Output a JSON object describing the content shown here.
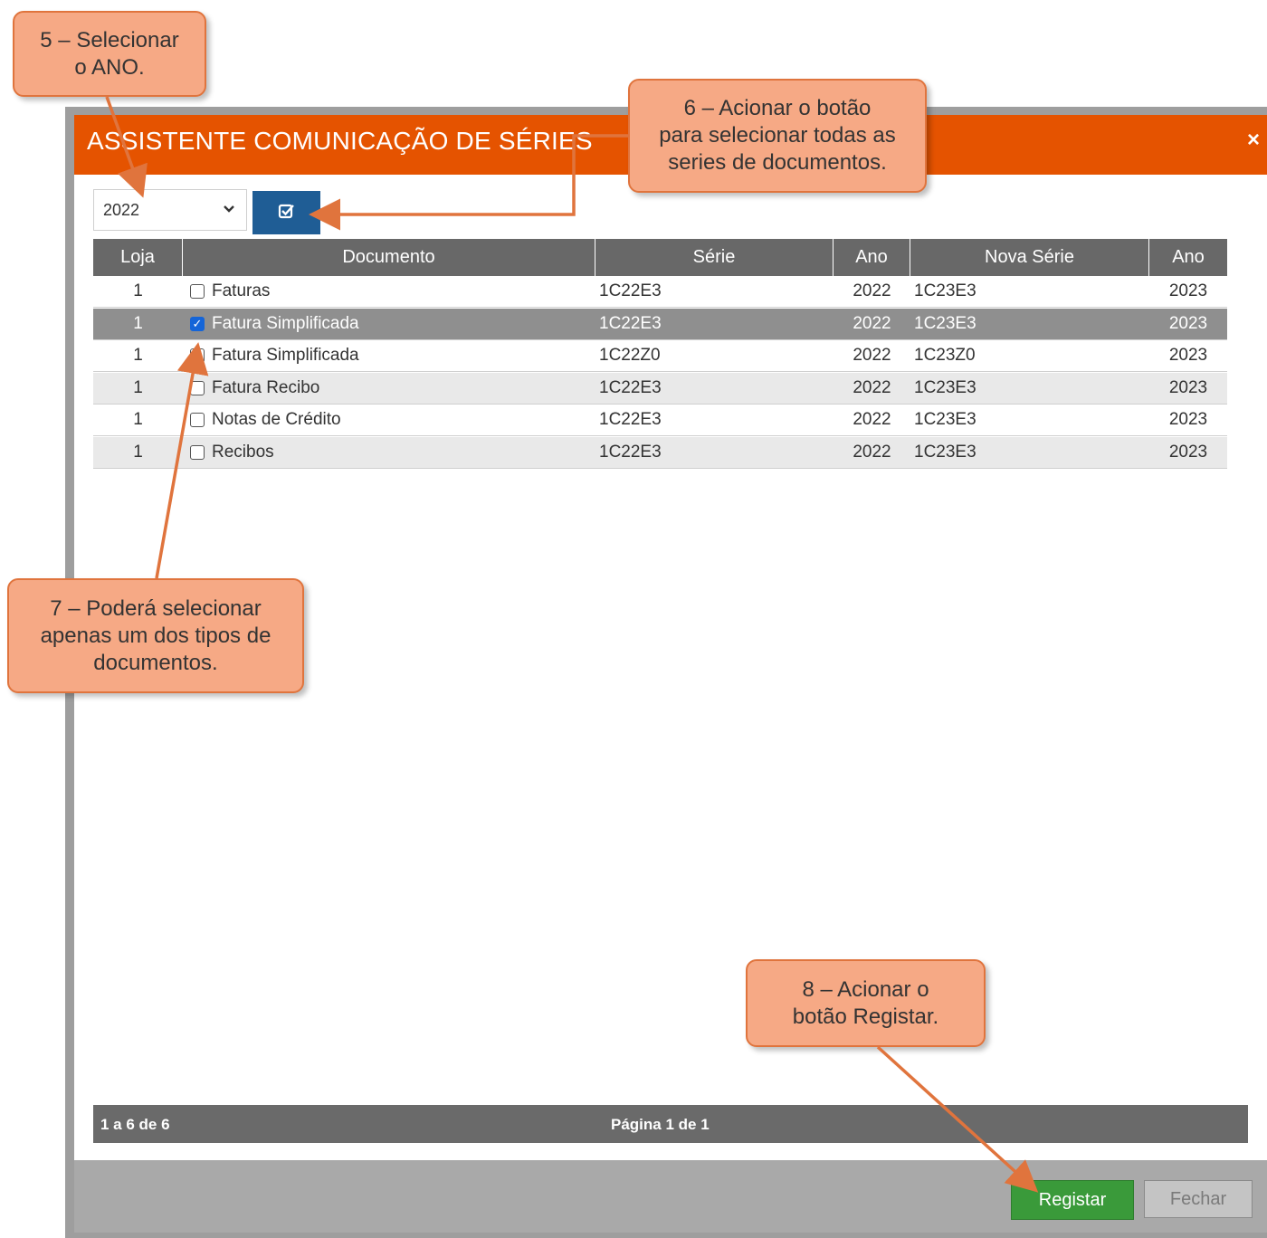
{
  "dialog": {
    "title": "ASSISTENTE COMUNICAÇÃO DE SÉRIES",
    "close_glyph": "×",
    "year_select": {
      "value": "2022",
      "chevron": "⌄"
    },
    "select_all_icon": "check-square-icon"
  },
  "grid": {
    "columns": [
      "Loja",
      "Documento",
      "Série",
      "Ano",
      "Nova Série",
      "Ano"
    ],
    "rows": [
      {
        "loja": "1",
        "documento": "Faturas",
        "serie": "1C22E3",
        "ano": "2022",
        "nova_serie": "1C23E3",
        "novo_ano": "2023",
        "checked": false
      },
      {
        "loja": "1",
        "documento": "Fatura Simplificada",
        "serie": "1C22E3",
        "ano": "2022",
        "nova_serie": "1C23E3",
        "novo_ano": "2023",
        "checked": true
      },
      {
        "loja": "1",
        "documento": "Fatura Simplificada",
        "serie": "1C22Z0",
        "ano": "2022",
        "nova_serie": "1C23Z0",
        "novo_ano": "2023",
        "checked": false
      },
      {
        "loja": "1",
        "documento": "Fatura Recibo",
        "serie": "1C22E3",
        "ano": "2022",
        "nova_serie": "1C23E3",
        "novo_ano": "2023",
        "checked": false
      },
      {
        "loja": "1",
        "documento": "Notas de Crédito",
        "serie": "1C22E3",
        "ano": "2022",
        "nova_serie": "1C23E3",
        "novo_ano": "2023",
        "checked": false
      },
      {
        "loja": "1",
        "documento": "Recibos",
        "serie": "1C22E3",
        "ano": "2022",
        "nova_serie": "1C23E3",
        "novo_ano": "2023",
        "checked": false
      }
    ],
    "footer": {
      "count": "1 a 6 de 6",
      "page": "Página 1 de 1"
    }
  },
  "buttons": {
    "register": "Registar",
    "close": "Fechar"
  },
  "callouts": {
    "c5": "5 – Selecionar\no ANO.",
    "c6": "6 – Acionar o botão\npara selecionar todas as\nseries de documentos.",
    "c7": "7 – Poderá selecionar\napenas um dos tipos de\ndocumentos.",
    "c8": "8 – Acionar o\nbotão Registar."
  },
  "colors": {
    "title_bar": "#e55300",
    "callout_fill": "#f6a985",
    "callout_border": "#e0743d",
    "select_all_button": "#1f5d95",
    "register_button": "#3a9a3a"
  }
}
